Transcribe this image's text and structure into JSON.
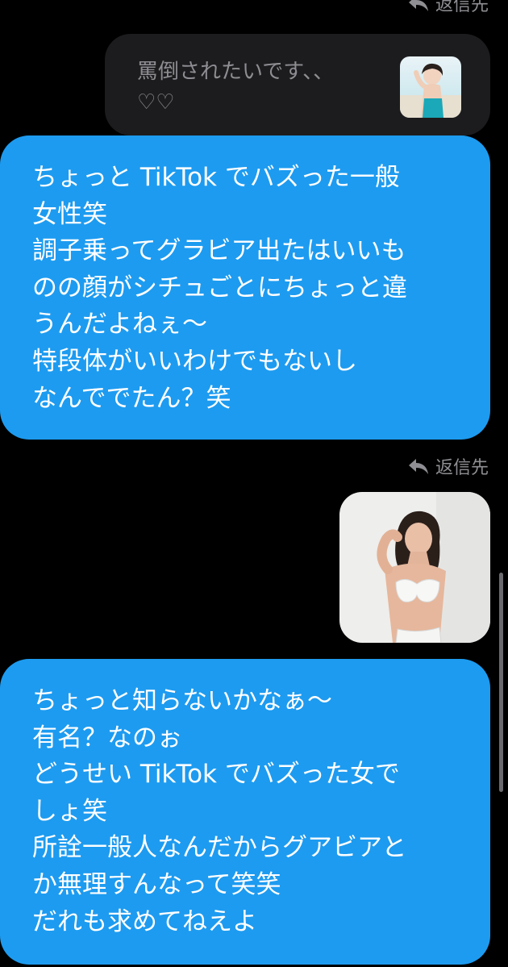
{
  "thread": {
    "reply_label_top": "返信先",
    "quoted_message": {
      "line1": "罵倒されたいです、、",
      "line2": "♡♡"
    },
    "message1": {
      "lines": [
        "ちょっと TikTok でバズった一般",
        "女性笑",
        "調子乗ってグラビア出たはいいも",
        "のの顔がシチュごとにちょっと違",
        "うんだよねぇ〜",
        "特段体がいいわけでもないし",
        "なんででたん？笑"
      ]
    },
    "reply_label_middle": "返信先",
    "message2": {
      "lines": [
        "ちょっと知らないかなぁ〜",
        "有名？なのぉ",
        "どうせい TikTok でバズった女で",
        "しょ笑",
        "所詮一般人なんだからグアビアと",
        "か無理すんなって笑笑",
        "だれも求めてねえよ"
      ]
    }
  },
  "colors": {
    "bubble": "#1d9bf0",
    "quoted_bubble": "#1c1c1e",
    "label": "#8e8e93"
  },
  "icons": {
    "reply": "reply-arrow-icon"
  }
}
